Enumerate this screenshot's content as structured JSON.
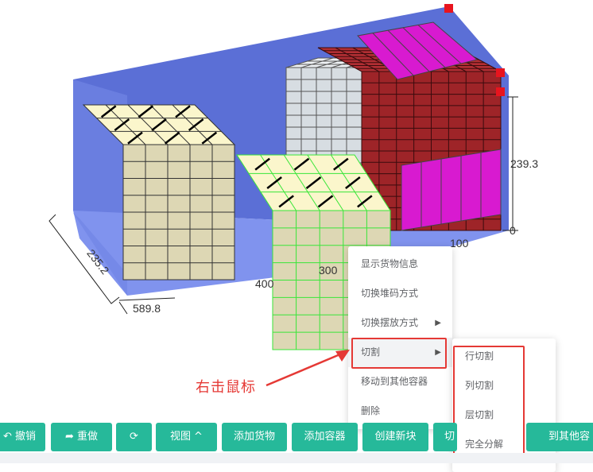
{
  "scene": {
    "dimensions": {
      "depth": "235.2",
      "length": "589.8",
      "height": "239.3",
      "height_zero": "0",
      "width_mark": "100",
      "selected_block_width": "400",
      "selected_block_depth": "300"
    },
    "colors": {
      "container_wall": "#5b6fd6",
      "container_floor": "#8093ee",
      "corner_marker": "#e8141e",
      "cream_box": "#ddd7b4",
      "cream_top": "#fbf6cc",
      "selected_outline": "#39e639",
      "dark_red_box": "#9e2428",
      "magenta_box": "#d81ad0",
      "silver_box": "#d7dde2"
    }
  },
  "context_menu": {
    "items": [
      {
        "label": "显示货物信息"
      },
      {
        "label": "切换堆码方式"
      },
      {
        "label": "切换摆放方式"
      },
      {
        "label": "切割"
      },
      {
        "label": "移动到其他容器"
      },
      {
        "label": "删除"
      }
    ],
    "submenu": {
      "items": [
        {
          "label": "行切割"
        },
        {
          "label": "列切割"
        },
        {
          "label": "层切割"
        },
        {
          "label": "完全分解"
        }
      ]
    }
  },
  "annotation": {
    "text": "右击鼠标"
  },
  "toolbar": {
    "undo": "撤销",
    "redo": "重做",
    "view": "视图",
    "add_cargo": "添加货物",
    "add_container": "添加容器",
    "new_block": "创建新块",
    "cut_partial": "切",
    "move_partial": "到其他容"
  }
}
